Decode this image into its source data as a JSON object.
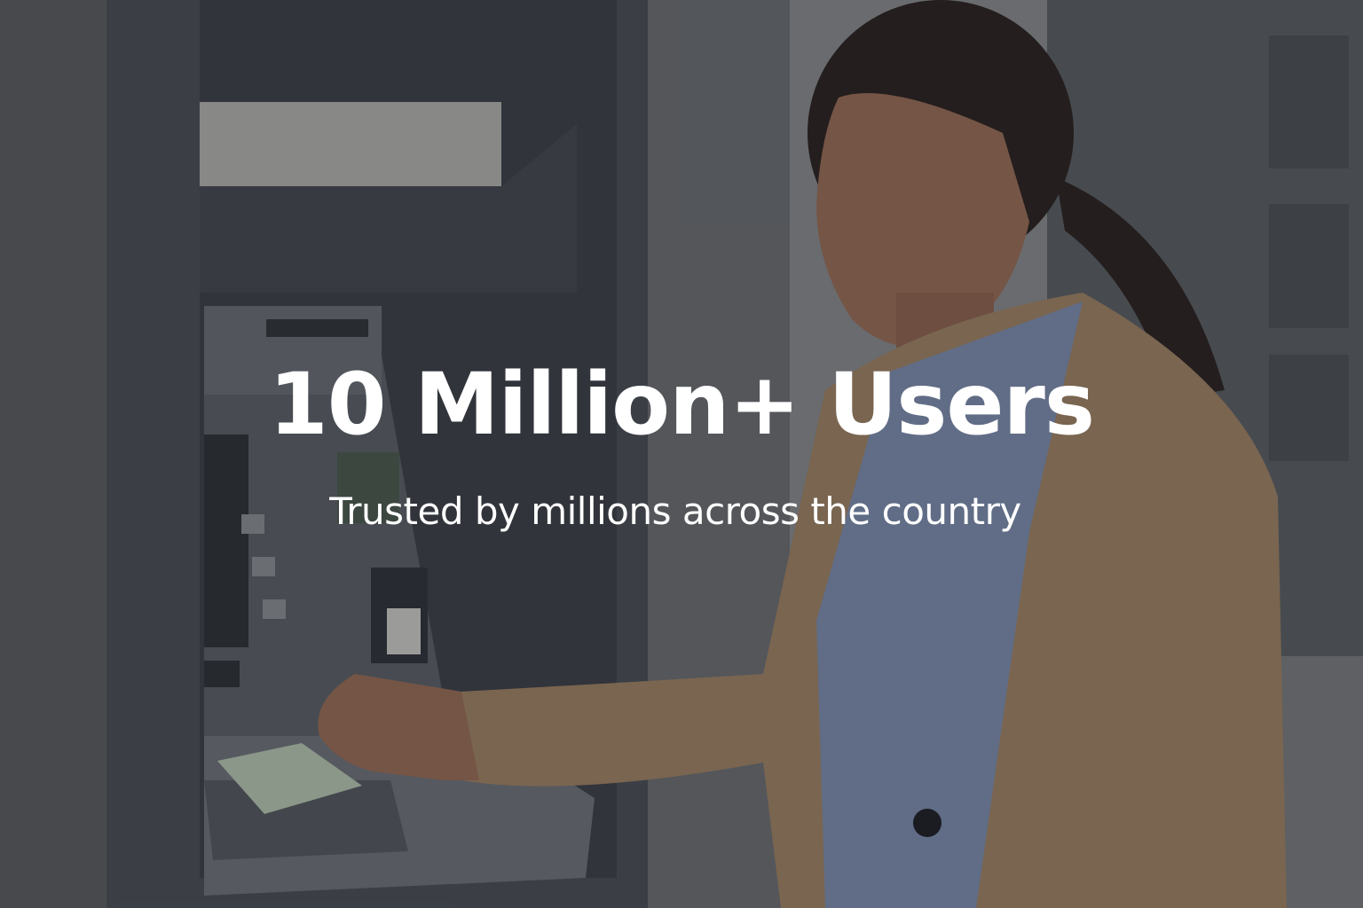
{
  "hero": {
    "headline": "10 Million+ Users",
    "subline": "Trusted by millions across the country"
  },
  "scene": {
    "subject": "woman in beige blazer withdrawing cash at ATM",
    "colors": {
      "wall": "#6f7277",
      "atm_frame": "#4a4f57",
      "atm_body": "#5c6168",
      "blazer": "#a08466",
      "shirt": "#7e8fb0",
      "hair": "#2a2220",
      "skin": "#9a6e58",
      "cash": "#b7c9b5"
    }
  }
}
